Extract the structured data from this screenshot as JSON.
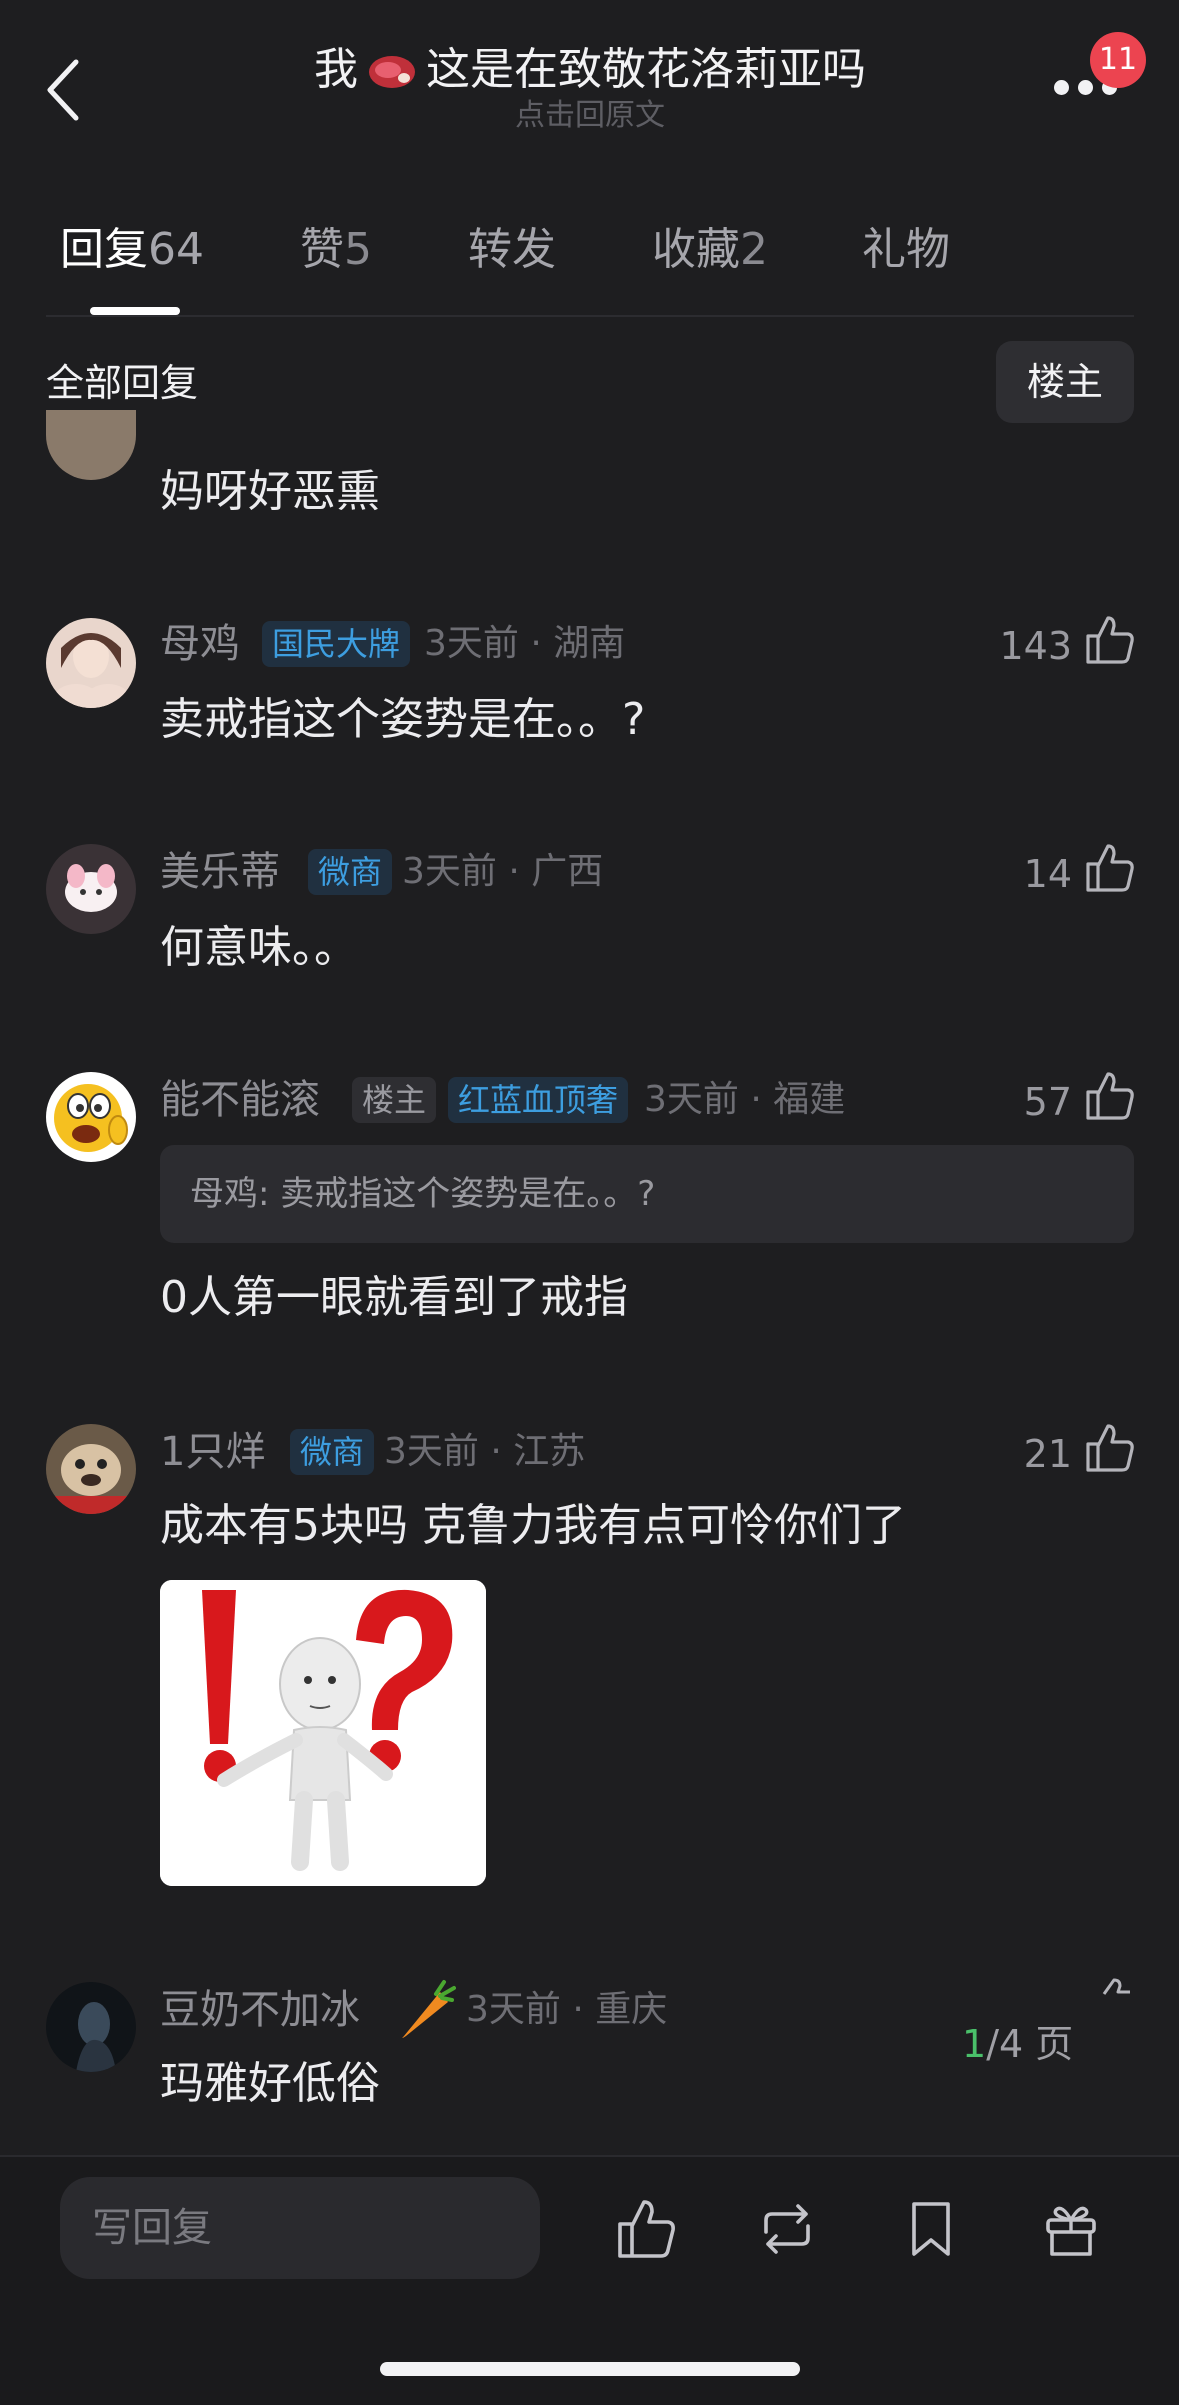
{
  "header": {
    "title_prefix": "我",
    "title_suffix": "这是在致敬花洛莉亚吗",
    "subtitle": "点击回原文",
    "notification_count": "11"
  },
  "tabs": [
    {
      "label": "回复",
      "count": "64",
      "active": true
    },
    {
      "label": "赞",
      "count": "5",
      "active": false
    },
    {
      "label": "转发",
      "count": "",
      "active": false
    },
    {
      "label": "收藏",
      "count": "2",
      "active": false
    },
    {
      "label": "礼物",
      "count": "",
      "active": false
    }
  ],
  "filter": {
    "title": "全部回复",
    "owner_button": "楼主"
  },
  "comments": [
    {
      "text": "妈呀好恶熏"
    },
    {
      "name": "母鸡",
      "tag": "国民大牌",
      "meta": "3天前 · 湖南",
      "likes": "143",
      "text": "卖戒指这个姿势是在。。?"
    },
    {
      "name": "美乐蒂",
      "tag": "微商",
      "meta": "3天前 · 广西",
      "likes": "14",
      "text": "何意味。。"
    },
    {
      "name": "能不能滚",
      "owner_tag": "楼主",
      "tag": "红蓝血顶奢",
      "meta": "3天前 · 福建",
      "likes": "57",
      "quote": "母鸡: 卖戒指这个姿势是在。。?",
      "text": "0人第一眼就看到了戒指"
    },
    {
      "name": "1只烊",
      "tag": "微商",
      "meta": "3天前 · 江苏",
      "likes": "21",
      "text": "成本有5块吗 克鲁力我有点可怜你们了"
    },
    {
      "name": "豆奶不加冰",
      "meta": "3天前 · 重庆",
      "text": "玛雅好低俗"
    }
  ],
  "page_indicator": {
    "current": "1",
    "total": "/4 页"
  },
  "bottom_bar": {
    "reply_placeholder": "写回复"
  },
  "colors": {
    "background": "#1e1e20",
    "badge": "#ec4450",
    "tag_blue": "#3d9ee0",
    "page_current": "#4ac06a"
  }
}
